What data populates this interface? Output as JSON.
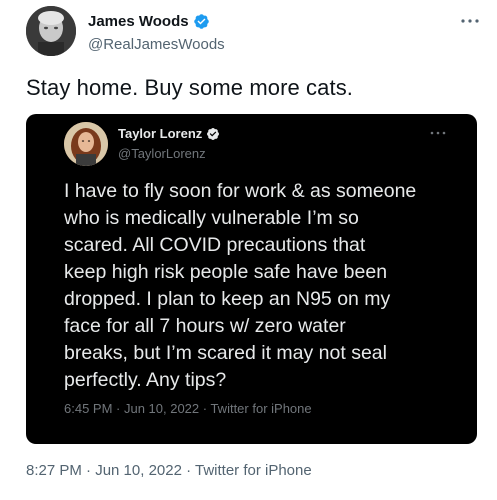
{
  "tweet": {
    "author": {
      "name": "James Woods",
      "handle": "@RealJamesWoods",
      "verified": true
    },
    "text": "Stay home. Buy some more cats.",
    "meta": {
      "time": "8:27 PM",
      "date": "Jun 10, 2022",
      "source": "Twitter for iPhone",
      "line": "8:27 PM · Jun 10, 2022 · Twitter for iPhone"
    }
  },
  "quoted_tweet": {
    "author": {
      "name": "Taylor Lorenz",
      "handle": "@TaylorLorenz",
      "verified": true
    },
    "text_lines": [
      "I have to fly soon for work & as someone",
      "who is medically vulnerable I’m so",
      "scared. All COVID precautions that",
      "keep high risk people safe have been",
      "dropped. I plan to keep an N95 on my",
      "face for all 7 hours w/ zero water",
      "breaks, but I’m scared it may not seal",
      "perfectly. Any tips?"
    ],
    "meta": {
      "line": "6:45 PM · Jun 10, 2022 · Twitter for iPhone"
    }
  },
  "colors": {
    "accent": "#1d9bf0",
    "text_primary": "#0f1419",
    "text_secondary": "#536471",
    "quote_bg": "#000000",
    "quote_text": "#e7e9ea",
    "quote_secondary": "#71767b"
  },
  "icons": {
    "verified": "verified-badge-icon",
    "more": "more-options-icon"
  }
}
